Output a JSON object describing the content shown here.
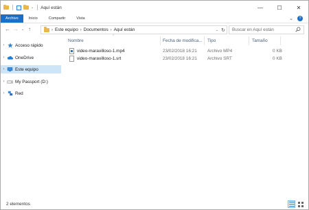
{
  "window": {
    "title": "Aquí están",
    "controls": {
      "minimize": "—",
      "maximize": "☐",
      "close": "✕"
    }
  },
  "ribbon": {
    "tabs": [
      "Archivo",
      "Inicio",
      "Compartir",
      "Vista"
    ],
    "expand_glyph": "⌄",
    "help_glyph": "?"
  },
  "navigation": {
    "back": "←",
    "forward": "→",
    "recent": "⌄",
    "up": "↑"
  },
  "address": {
    "crumbs": [
      "Este equipo",
      "Documentos",
      "Aquí están"
    ],
    "separator": "›",
    "dropdown_glyph": "⌄",
    "refresh_glyph": "↻"
  },
  "search": {
    "placeholder": "Buscar en Aquí están"
  },
  "sidebar": {
    "items": [
      {
        "label": "Acceso rápido",
        "icon": "star-icon",
        "chevron": "›"
      },
      {
        "label": "OneDrive",
        "icon": "cloud-icon",
        "chevron": "›"
      },
      {
        "label": "Este equipo",
        "icon": "computer-icon",
        "chevron": "›",
        "selected": true
      },
      {
        "label": "My Passport (D:)",
        "icon": "drive-icon",
        "chevron": "›"
      },
      {
        "label": "Red",
        "icon": "network-icon",
        "chevron": "›"
      }
    ]
  },
  "columns": {
    "name": "Nombre",
    "date": "Fecha de modifica...",
    "type": "Tipo",
    "size": "Tamaño",
    "sort_glyph": "⌃"
  },
  "files": [
    {
      "name": "video-maravilloso-1.mp4",
      "date": "23/02/2018 16:21",
      "type": "Archivo MP4",
      "size": "0 KB",
      "icon": "video-file-icon"
    },
    {
      "name": "video-maravilloso-1.srt",
      "date": "23/02/2018 16:21",
      "type": "Archivo SRT",
      "size": "0 KB",
      "icon": "text-file-icon"
    }
  ],
  "status": {
    "count": "2 elementos"
  },
  "colors": {
    "accent": "#1a6fc8",
    "selection": "#cde5f7",
    "folder": "#e8b84a"
  }
}
